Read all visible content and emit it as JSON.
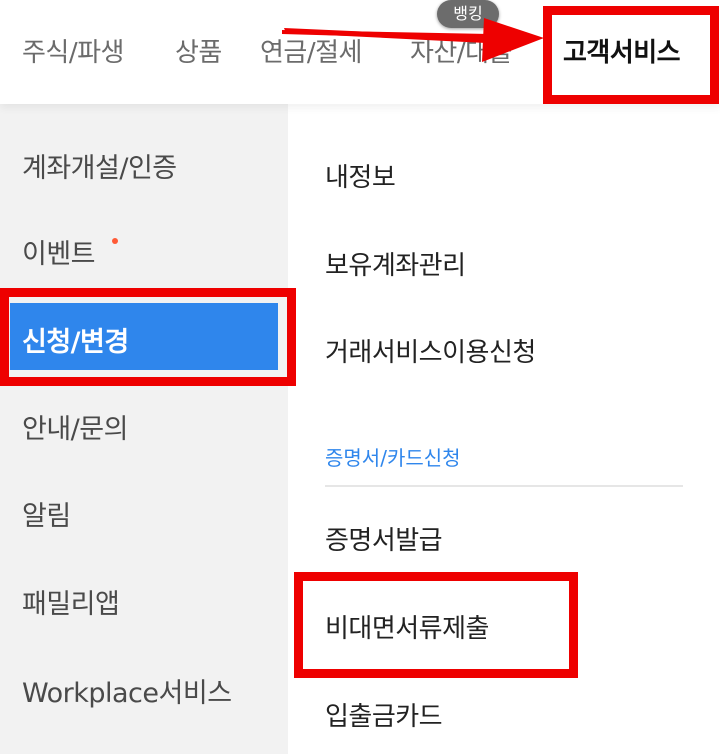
{
  "top_tabs": [
    {
      "label": "주식/파생"
    },
    {
      "label": "상품"
    },
    {
      "label": "연금/절세"
    },
    {
      "label": "자산/대출"
    },
    {
      "label": "고객서비스",
      "active": true
    }
  ],
  "badge": "뱅킹",
  "sidebar": {
    "items": [
      {
        "label": "계좌개설/인증"
      },
      {
        "label": "이벤트",
        "has_dot": true
      },
      {
        "label": "신청/변경",
        "active": true
      },
      {
        "label": "안내/문의"
      },
      {
        "label": "알림"
      },
      {
        "label": "패밀리앱"
      },
      {
        "label": "Workplace서비스"
      }
    ]
  },
  "main": {
    "items": [
      {
        "label": "내정보"
      },
      {
        "label": "보유계좌관리"
      },
      {
        "label": "거래서비스이용신청"
      }
    ],
    "section": {
      "label": "증명서/카드신청",
      "items": [
        {
          "label": "증명서발급"
        },
        {
          "label": "비대면서류제출"
        },
        {
          "label": "입출금카드"
        }
      ]
    }
  },
  "colors": {
    "accent": "#2f86ec",
    "highlight": "#ee0000",
    "sidebar_bg": "#f2f2f2",
    "event_dot": "#ff5a36"
  }
}
